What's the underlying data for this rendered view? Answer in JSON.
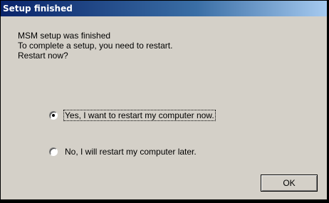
{
  "window": {
    "title": "Setup finished"
  },
  "message": {
    "line1": "MSM setup was finished",
    "line2": "To complete a setup, you need to restart.",
    "line3": "Restart now?"
  },
  "options": [
    {
      "label": "Yes, I want to restart my computer now.",
      "selected": true
    },
    {
      "label": "No, I will restart my computer later.",
      "selected": false
    }
  ],
  "buttons": {
    "ok_label": "OK"
  },
  "colors": {
    "titlebar_start": "#0a246a",
    "dialog_face": "#d4d0c8"
  }
}
